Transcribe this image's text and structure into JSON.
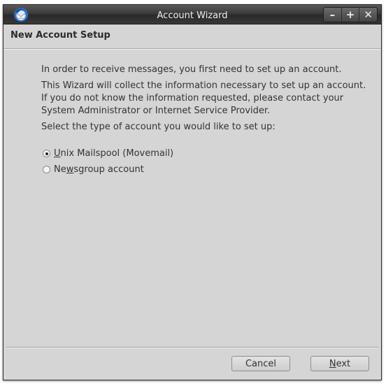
{
  "window": {
    "title": "Account Wizard"
  },
  "wm_buttons": {
    "minimize": "–",
    "maximize": "+",
    "close": "✕"
  },
  "header": {
    "title": "New Account Setup"
  },
  "content": {
    "p1": "In order to receive messages, you first need to set up an account.",
    "p2": "This Wizard will collect the information necessary to set up an account. If you do not know the information requested, please contact your System Administrator or Internet Service Provider.",
    "p3": "Select the type of account you would like to set up:"
  },
  "options": [
    {
      "mnemonic": "U",
      "rest": "nix Mailspool (Movemail)",
      "checked": true
    },
    {
      "pre": "Ne",
      "mnemonic": "w",
      "rest": "sgroup account",
      "checked": false
    }
  ],
  "buttons": {
    "cancel": "Cancel",
    "next_mnemonic": "N",
    "next_rest": "ext"
  },
  "icons": {
    "app": "thunderbird-icon"
  }
}
